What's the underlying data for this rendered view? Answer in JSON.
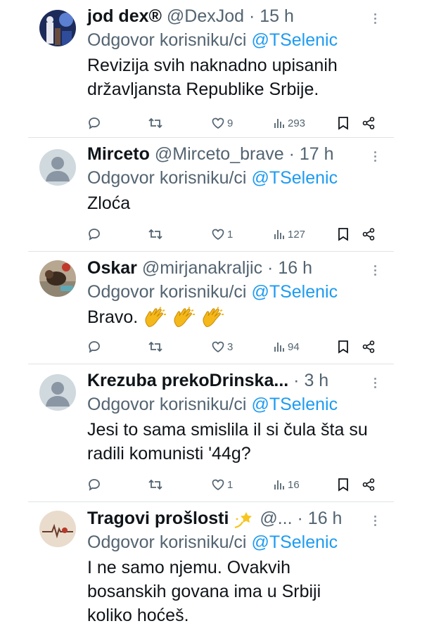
{
  "tweets": [
    {
      "name": "jod dex®",
      "handle": "@DexJod",
      "separator": "·",
      "time": "15 h",
      "reply_prefix": "Odgovor korisniku/ci",
      "reply_to": "@TSelenic",
      "text": "Revizija svih naknadno upisanih državljansta Republike Srbije.",
      "likes": "9",
      "views": "293",
      "avatar": "photo-avatar"
    },
    {
      "name": "Mirceto",
      "handle": "@Mirceto_brave",
      "separator": "·",
      "time": "17 h",
      "reply_prefix": "Odgovor korisniku/ci",
      "reply_to": "@TSelenic",
      "text": "Zloća",
      "likes": "1",
      "views": "127",
      "avatar": "default-avatar"
    },
    {
      "name": "Oskar",
      "handle": "@mirjanakraljic",
      "separator": "·",
      "time": "16 h",
      "reply_prefix": "Odgovor korisniku/ci",
      "reply_to": "@TSelenic",
      "text": "Bravo.",
      "text_emoji": "clapping-hands-icon x3",
      "likes": "3",
      "views": "94",
      "avatar": "dog-photo-avatar"
    },
    {
      "name": "Krezuba prekoDrinska...",
      "handle": "",
      "separator": "·",
      "time": "3 h",
      "reply_prefix": "Odgovor korisniku/ci",
      "reply_to": "@TSelenic",
      "text": "Jesi to sama smislila il si čula šta su radili komunisti '44g?",
      "likes": "1",
      "views": "16",
      "avatar": "default-avatar"
    },
    {
      "name": "Tragovi prošlosti",
      "name_emoji": "dizzy-star-icon",
      "handle": "@...",
      "separator": "·",
      "time": "16 h",
      "reply_prefix": "Odgovor korisniku/ci",
      "reply_to": "@TSelenic",
      "text": "I ne samo njemu. Ovakvih bosanskih govana ima u Srbiji koliko hoćeš.",
      "avatar": "sketch-avatar"
    }
  ],
  "colors": {
    "text_primary": "#0f1419",
    "text_secondary": "#536471",
    "mention": "#1d9bf0",
    "divider": "#dfe3e6"
  },
  "icons": [
    "reply-icon",
    "retweet-icon",
    "like-icon",
    "views-icon",
    "bookmark-icon",
    "share-icon",
    "more-icon"
  ]
}
